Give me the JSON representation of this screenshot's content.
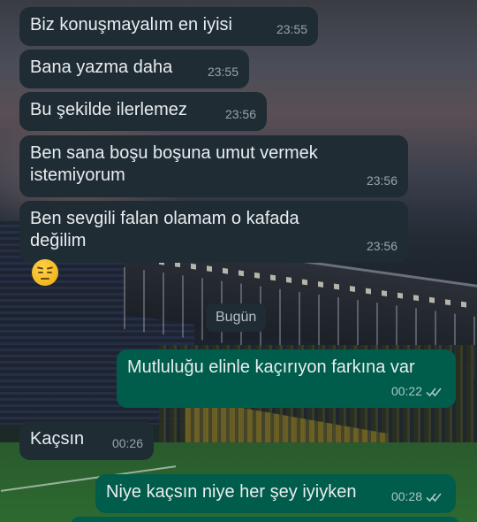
{
  "colors": {
    "incoming_bubble": "#1f2c34",
    "outgoing_bubble": "#005c4b",
    "message_text": "#e9edef",
    "timestamp_text": "#9aa3a8",
    "read_ticks": "#a9c7c0"
  },
  "wallpaper": {
    "icon": "stadium-photo"
  },
  "messages": [
    {
      "text": "Biz konuşmayalım en iyisi",
      "time": "23:55"
    },
    {
      "text": "Bana yazma daha",
      "time": "23:55"
    },
    {
      "text": "Bu şekilde ilerlemez",
      "time": "23:56"
    },
    {
      "text": "Ben sana boşu boşuna umut vermek istemiyorum",
      "time": "23:56"
    },
    {
      "text": "Ben sevgili falan olamam o kafada değilim",
      "time": "23:56"
    },
    {
      "text": "Mutluluğu elinle kaçırıyon farkına var",
      "time": "00:22",
      "status": "double-check-icon"
    },
    {
      "text": "Kaçsın",
      "time": "00:26"
    },
    {
      "text": "Niye kaçsın niye her şey iyiyken",
      "time": "00:28",
      "status": "double-check-icon"
    }
  ],
  "emoji_message": {
    "icon": "unamused-face-emoji"
  },
  "date_separator": "Bugün"
}
